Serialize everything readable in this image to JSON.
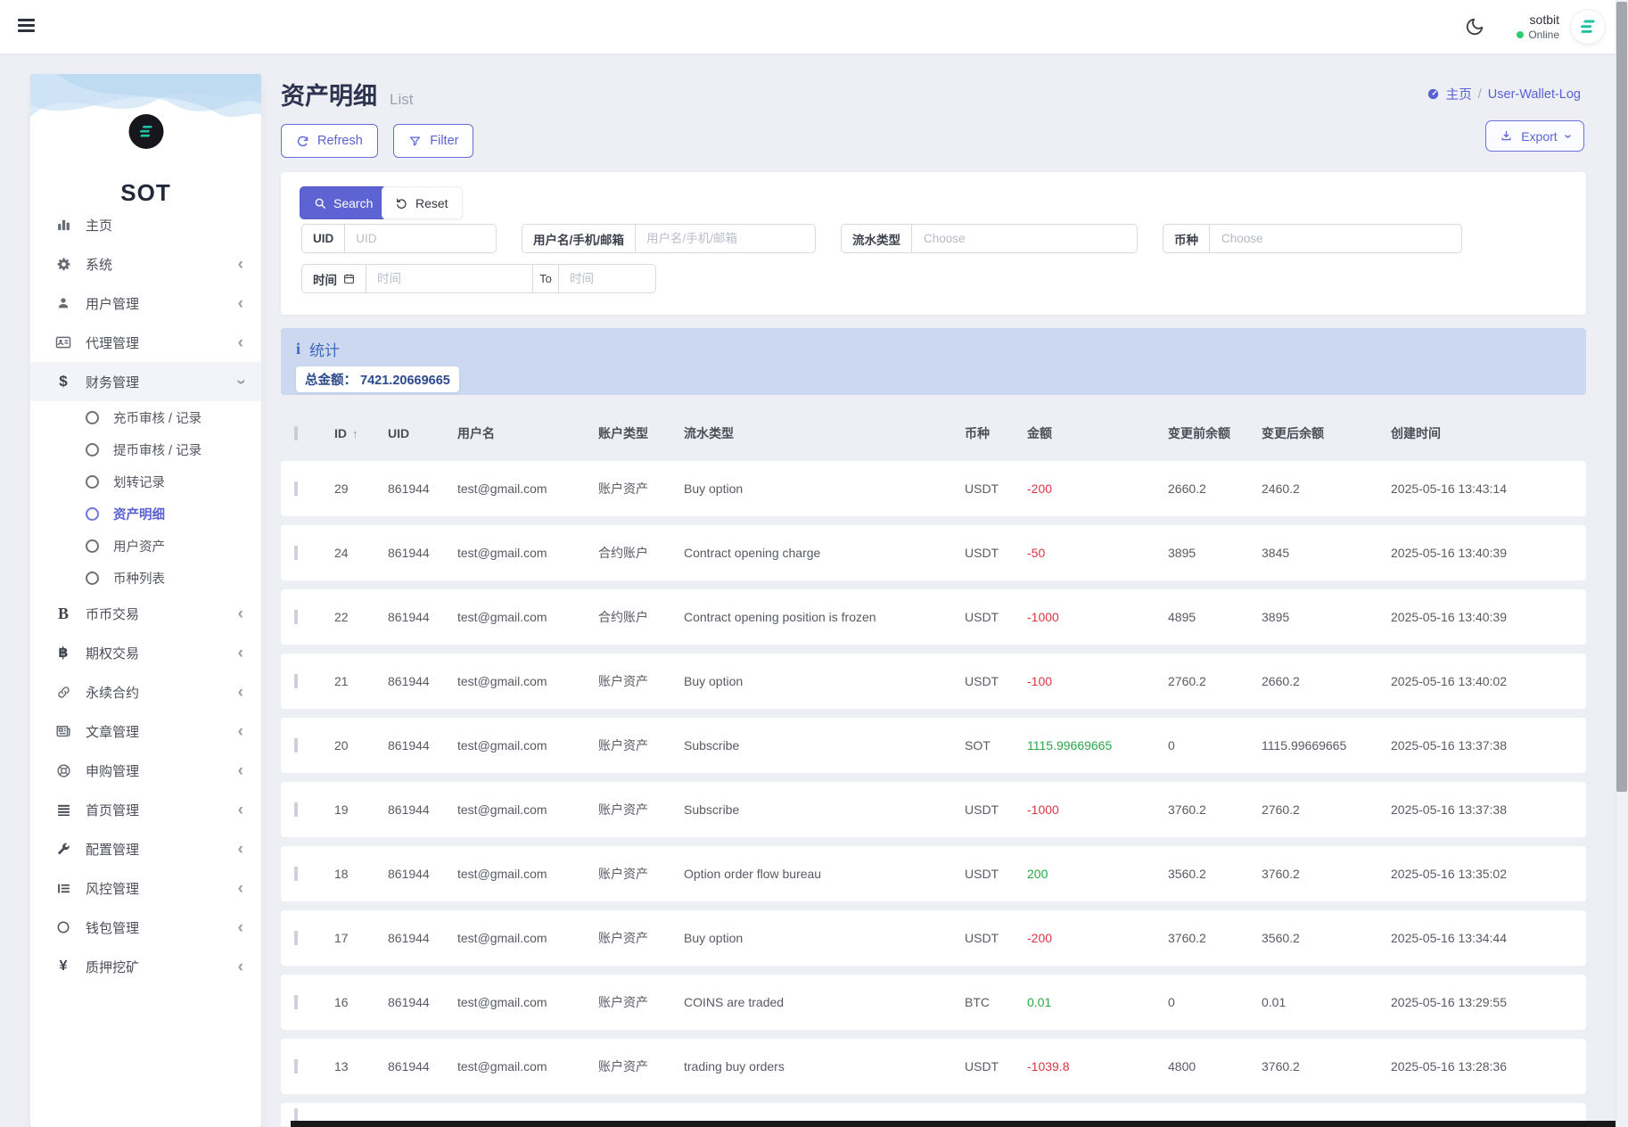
{
  "navbar": {
    "user": "sotbit",
    "status": "Online"
  },
  "sidebar": {
    "brand": "SOT",
    "items": [
      {
        "label": "主页",
        "icon": "chart-bar-icon",
        "chevron": null
      },
      {
        "label": "系统",
        "icon": "gear-icon",
        "chevron": "left"
      },
      {
        "label": "用户管理",
        "icon": "user-icon",
        "chevron": "left"
      },
      {
        "label": "代理管理",
        "icon": "id-card-icon",
        "chevron": "left"
      },
      {
        "label": "财务管理",
        "icon": "dollar-icon",
        "chevron": "down",
        "expanded": true,
        "children": [
          {
            "label": "充币审核 / 记录"
          },
          {
            "label": "提币审核 / 记录"
          },
          {
            "label": "划转记录"
          },
          {
            "label": "资产明细",
            "active": true
          },
          {
            "label": "用户资产"
          },
          {
            "label": "币种列表"
          }
        ]
      },
      {
        "label": "币币交易",
        "icon": "b-icon",
        "chevron": "left"
      },
      {
        "label": "期权交易",
        "icon": "bitcoin-icon",
        "chevron": "left"
      },
      {
        "label": "永续合约",
        "icon": "link-icon",
        "chevron": "left"
      },
      {
        "label": "文章管理",
        "icon": "newspaper-icon",
        "chevron": "left"
      },
      {
        "label": "申购管理",
        "icon": "life-ring-icon",
        "chevron": "left"
      },
      {
        "label": "首页管理",
        "icon": "lines-icon",
        "chevron": "left"
      },
      {
        "label": "配置管理",
        "icon": "wrench-icon",
        "chevron": "left"
      },
      {
        "label": "风控管理",
        "icon": "list-alt-icon",
        "chevron": "left"
      },
      {
        "label": "钱包管理",
        "icon": "circle-icon",
        "chevron": "left"
      },
      {
        "label": "质押挖矿",
        "icon": "yen-icon",
        "chevron": "left"
      }
    ]
  },
  "header": {
    "title": "资产明细",
    "subtitle": "List",
    "breadcrumb_home": "主页",
    "breadcrumb_sep": "/",
    "breadcrumb_current": "User-Wallet-Log"
  },
  "toolbar": {
    "refresh": "Refresh",
    "filter": "Filter",
    "export": "Export"
  },
  "filters": {
    "search": "Search",
    "reset": "Reset",
    "uid_label": "UID",
    "uid_placeholder": "UID",
    "user_label": "用户名/手机/邮箱",
    "user_placeholder": "用户名/手机/邮箱",
    "flow_label": "流水类型",
    "flow_placeholder": "Choose",
    "coin_label": "币种",
    "coin_placeholder": "Choose",
    "time_label": "时间",
    "time_placeholder": "时间",
    "to_label": "To",
    "time2_placeholder": "时间"
  },
  "stats": {
    "title": "统计",
    "total_label": "总金额：",
    "total_value": "7421.20669665"
  },
  "table": {
    "sort_indicator": "↑",
    "headers": [
      "ID",
      "UID",
      "用户名",
      "账户类型",
      "流水类型",
      "币种",
      "金额",
      "变更前余额",
      "变更后余额",
      "创建时间"
    ],
    "rows": [
      {
        "id": "29",
        "uid": "861944",
        "username": "test@gmail.com",
        "account_type": "账户资产",
        "flow_type": "Buy option",
        "coin": "USDT",
        "amount": "-200",
        "before": "2660.2",
        "after": "2460.2",
        "created": "2025-05-16 13:43:14"
      },
      {
        "id": "24",
        "uid": "861944",
        "username": "test@gmail.com",
        "account_type": "合约账户",
        "flow_type": "Contract opening charge",
        "coin": "USDT",
        "amount": "-50",
        "before": "3895",
        "after": "3845",
        "created": "2025-05-16 13:40:39"
      },
      {
        "id": "22",
        "uid": "861944",
        "username": "test@gmail.com",
        "account_type": "合约账户",
        "flow_type": "Contract opening position is frozen",
        "coin": "USDT",
        "amount": "-1000",
        "before": "4895",
        "after": "3895",
        "created": "2025-05-16 13:40:39"
      },
      {
        "id": "21",
        "uid": "861944",
        "username": "test@gmail.com",
        "account_type": "账户资产",
        "flow_type": "Buy option",
        "coin": "USDT",
        "amount": "-100",
        "before": "2760.2",
        "after": "2660.2",
        "created": "2025-05-16 13:40:02"
      },
      {
        "id": "20",
        "uid": "861944",
        "username": "test@gmail.com",
        "account_type": "账户资产",
        "flow_type": "Subscribe",
        "coin": "SOT",
        "amount": "1115.99669665",
        "before": "0",
        "after": "1115.99669665",
        "created": "2025-05-16 13:37:38"
      },
      {
        "id": "19",
        "uid": "861944",
        "username": "test@gmail.com",
        "account_type": "账户资产",
        "flow_type": "Subscribe",
        "coin": "USDT",
        "amount": "-1000",
        "before": "3760.2",
        "after": "2760.2",
        "created": "2025-05-16 13:37:38"
      },
      {
        "id": "18",
        "uid": "861944",
        "username": "test@gmail.com",
        "account_type": "账户资产",
        "flow_type": "Option order flow bureau",
        "coin": "USDT",
        "amount": "200",
        "before": "3560.2",
        "after": "3760.2",
        "created": "2025-05-16 13:35:02"
      },
      {
        "id": "17",
        "uid": "861944",
        "username": "test@gmail.com",
        "account_type": "账户资产",
        "flow_type": "Buy option",
        "coin": "USDT",
        "amount": "-200",
        "before": "3760.2",
        "after": "3560.2",
        "created": "2025-05-16 13:34:44"
      },
      {
        "id": "16",
        "uid": "861944",
        "username": "test@gmail.com",
        "account_type": "账户资产",
        "flow_type": "COINS are traded",
        "coin": "BTC",
        "amount": "0.01",
        "before": "0",
        "after": "0.01",
        "created": "2025-05-16 13:29:55"
      },
      {
        "id": "13",
        "uid": "861944",
        "username": "test@gmail.com",
        "account_type": "账户资产",
        "flow_type": "trading buy orders",
        "coin": "USDT",
        "amount": "-1039.8",
        "before": "4800",
        "after": "3760.2",
        "created": "2025-05-16 13:28:36"
      }
    ],
    "partial_row_visible": true
  },
  "colors": {
    "accent": "#5d63d2",
    "negative": "#dc3545",
    "positive": "#28a745",
    "online": "#2ecc71",
    "stats_bg": "#cbd8f0",
    "logo_green": "#1fc3a2"
  }
}
